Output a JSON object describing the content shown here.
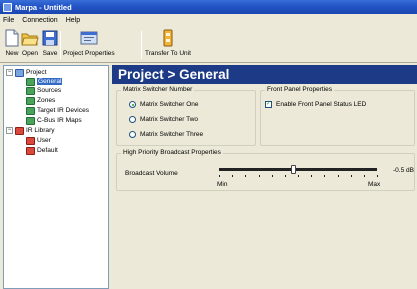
{
  "window": {
    "title": "Marpa - Untitled"
  },
  "menu": [
    "File",
    "Connection",
    "Help"
  ],
  "toolbar": {
    "new_label": "New",
    "open_label": "Open",
    "save_label": "Save",
    "project_properties_label": "Project Properties",
    "transfer_label": "Transfer To Unit"
  },
  "tree": {
    "project": "Project",
    "general": "General",
    "sources": "Sources",
    "zones": "Zones",
    "target_ir": "Target IR Devices",
    "cbus_ir": "C-Bus IR Maps",
    "ir_library": "IR Library",
    "user": "User",
    "default": "Default"
  },
  "header": {
    "title": "Project > General"
  },
  "matrix": {
    "legend": "Matrix Switcher Number",
    "options": [
      "Matrix Switcher One",
      "Matrix Switcher Two",
      "Matrix Switcher Three"
    ],
    "selected_index": 0
  },
  "front_panel": {
    "legend": "Front Panel Properties",
    "status_led_label": "Enable Front Panel Status LED",
    "status_led_checked": true
  },
  "broadcast": {
    "legend": "High Priority Broadcast Properties",
    "volume_label": "Broadcast Volume",
    "volume_value_text": "-0.5 dB",
    "min_label": "Min",
    "max_label": "Max",
    "volume_fraction": 0.47
  }
}
